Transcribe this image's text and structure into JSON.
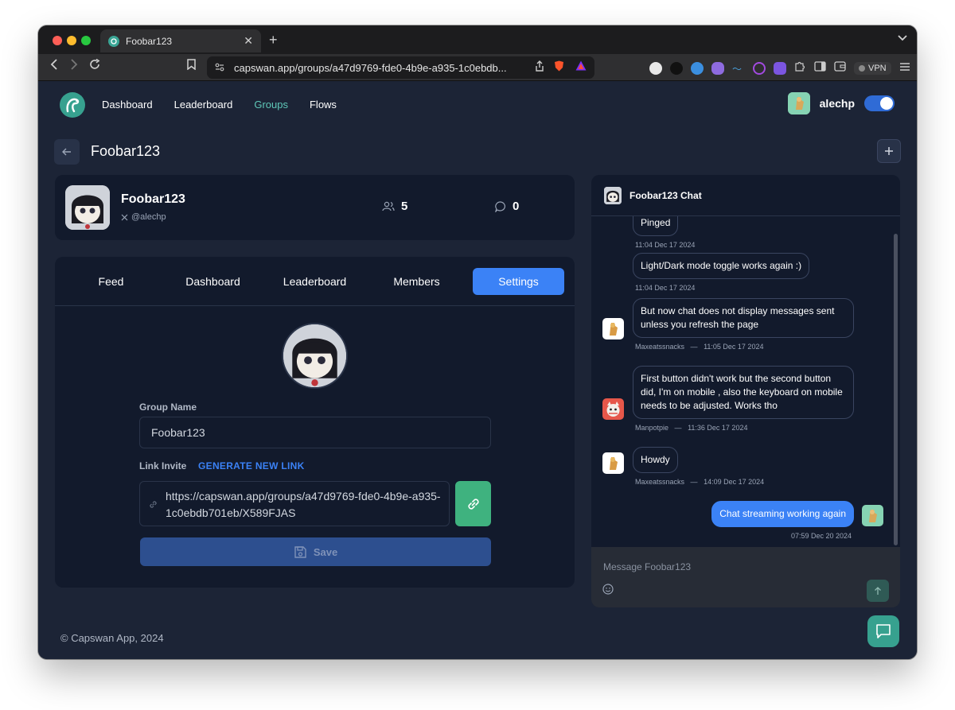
{
  "browser": {
    "tab_title": "Foobar123",
    "tab_close": "✕",
    "new_tab": "+",
    "url": "capswan.app/groups/a47d9769-fde0-4b9e-a935-1c0ebdb...",
    "vpn_label": "VPN"
  },
  "nav": {
    "items": [
      "Dashboard",
      "Leaderboard",
      "Groups",
      "Flows"
    ],
    "active": "Groups"
  },
  "user": {
    "name": "alechp",
    "dark_mode": true
  },
  "page": {
    "title": "Foobar123",
    "back_icon": "arrow-left-icon",
    "add_icon": "plus-icon"
  },
  "group": {
    "name": "Foobar123",
    "handle": "@alechp",
    "members_count": "5",
    "comments_count": "0"
  },
  "tabs": [
    "Feed",
    "Dashboard",
    "Leaderboard",
    "Members",
    "Settings"
  ],
  "active_tab": "Settings",
  "settings": {
    "group_name_label": "Group Name",
    "group_name_value": "Foobar123",
    "link_invite_label": "Link Invite",
    "generate_link_label": "GENERATE NEW LINK",
    "invite_url_line1": "https://capswan.app/groups/a47d9769-fde0-4b9e-a935-",
    "invite_url_line2": "1c0ebdb701eb/X589FJAS",
    "save_label": "Save"
  },
  "chat": {
    "title": "Foobar123 Chat",
    "placeholder": "Message Foobar123",
    "messages": [
      {
        "text": "Pinged",
        "meta": "11:04 Dec 17 2024"
      },
      {
        "text": "Light/Dark mode toggle works again :)",
        "meta": "11:04 Dec 17 2024"
      },
      {
        "text_line1": "But now chat does not display messages sent",
        "text_line2": "unless you refresh the page",
        "author": "Maxeatssnacks",
        "sep": "—",
        "time": "11:05 Dec 17 2024"
      },
      {
        "text_line1": "First button didn't work but the second button",
        "text_line2": "did, I'm on mobile , also the keyboard on mobile",
        "text_line3": "needs to be adjusted. Works tho",
        "author": "Manpotpie",
        "sep": "—",
        "time": "11:36 Dec 17 2024"
      },
      {
        "text": "Howdy",
        "author": "Maxeatssnacks",
        "sep": "—",
        "time": "14:09 Dec 17 2024"
      },
      {
        "text": "Chat streaming working again",
        "meta": "07:59 Dec 20 2024"
      }
    ]
  },
  "footer": {
    "copyright": "© Capswan App, 2024"
  },
  "colors": {
    "accent": "#3b82f6",
    "brand": "#37a18f",
    "background": "#1c2436",
    "card": "#121a2c"
  }
}
